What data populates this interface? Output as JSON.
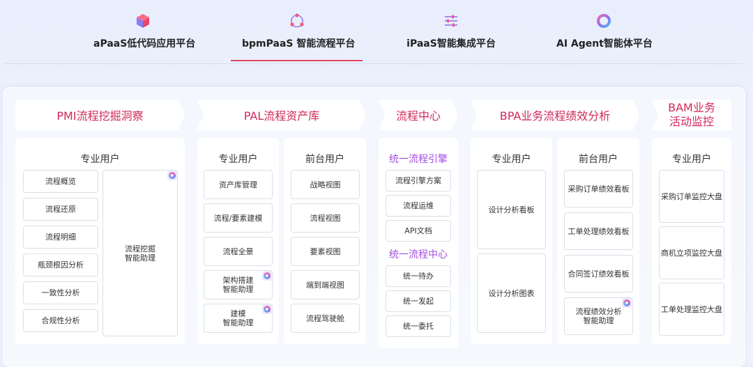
{
  "tabs": [
    {
      "label": "aPaaS低代码应用平台",
      "icon": "cube-icon",
      "active": false
    },
    {
      "label": "bpmPaaS 智能流程平台",
      "icon": "process-nodes-icon",
      "active": true
    },
    {
      "label": "iPaaS智能集成平台",
      "icon": "sliders-icon",
      "active": false
    },
    {
      "label": "AI Agent智能体平台",
      "icon": "ai-ring-icon",
      "active": false
    }
  ],
  "colors": {
    "accent": "#e0485f",
    "heading": "#d0285b",
    "subheading": "#a34de0"
  },
  "columns": {
    "pmi": {
      "title": "PMI流程挖掘洞察",
      "card": {
        "title": "专业用户",
        "items": [
          "流程概览",
          "流程还原",
          "流程明细",
          "瓶颈根因分析",
          "一致性分析",
          "合规性分析"
        ],
        "assistant": "流程挖掘\n智能助理"
      }
    },
    "pal": {
      "title": "PAL流程资产库",
      "pro": {
        "title": "专业用户",
        "items": [
          "资产库管理",
          "流程/要素建模",
          "流程全景",
          "架构搭建\n智能助理",
          "建模\n智能助理"
        ]
      },
      "front": {
        "title": "前台用户",
        "items": [
          "战略视图",
          "流程视图",
          "要素视图",
          "端到端视图",
          "流程驾驶舱"
        ]
      }
    },
    "center": {
      "title": "流程中心",
      "engine_title": "统一流程引擎",
      "engine_items": [
        "流程引擎方案",
        "流程运维",
        "API文档"
      ],
      "center_title": "统一流程中心",
      "center_items": [
        "统一待办",
        "统一发起",
        "统一委托"
      ]
    },
    "bpa": {
      "title": "BPA业务流程绩效分析",
      "pro": {
        "title": "专业用户",
        "items": [
          "设计分析看板",
          "设计分析图表"
        ]
      },
      "front": {
        "title": "前台用户",
        "items": [
          "采购订单绩效看板",
          "工单处理绩效看板",
          "合同签订绩效看板",
          "流程绩效分析\n智能助理"
        ]
      }
    },
    "bam": {
      "title": "BAM业务\n活动监控",
      "card": {
        "title": "专业用户",
        "items": [
          "采购订单监控大盘",
          "商机立项监控大盘",
          "工单处理监控大盘"
        ]
      }
    }
  }
}
